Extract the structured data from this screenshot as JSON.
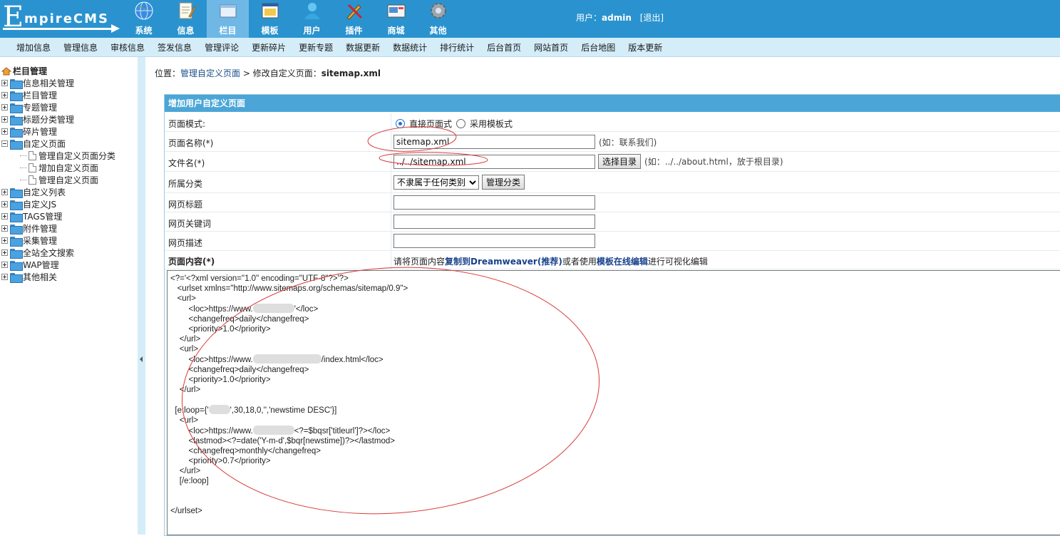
{
  "header": {
    "logo_initial": "E",
    "logo_rest": "mpireCMS",
    "nav": [
      {
        "label": "系统",
        "icon": "globe-icon"
      },
      {
        "label": "信息",
        "icon": "notepad-icon"
      },
      {
        "label": "栏目",
        "icon": "folder-icon"
      },
      {
        "label": "模板",
        "icon": "template-window-icon"
      },
      {
        "label": "用户",
        "icon": "user-icon"
      },
      {
        "label": "插件",
        "icon": "tools-icon"
      },
      {
        "label": "商城",
        "icon": "shop-icon"
      },
      {
        "label": "其他",
        "icon": "gear-icon"
      }
    ],
    "active_nav": "栏目",
    "user_prefix": "用户：",
    "username": "admin",
    "logout": "[退出]"
  },
  "submenu": [
    "增加信息",
    "管理信息",
    "审核信息",
    "签发信息",
    "管理评论",
    "更新碎片",
    "更新专题",
    "数据更新",
    "数据统计",
    "排行统计",
    "后台首页",
    "网站首页",
    "后台地图",
    "版本更新"
  ],
  "sidebar": {
    "title": "栏目管理",
    "items": [
      "信息相关管理",
      "栏目管理",
      "专题管理",
      "标题分类管理",
      "碎片管理",
      "自定义页面"
    ],
    "children": [
      "管理自定义页面分类",
      "增加自定义页面",
      "管理自定义页面"
    ],
    "items_after": [
      "自定义列表",
      "自定义JS",
      "TAGS管理",
      "附件管理",
      "采集管理",
      "全站全文搜索",
      "WAP管理",
      "其他相关"
    ]
  },
  "breadcrumb": {
    "prefix": "位置：",
    "link": "管理自定义页面",
    "sep": " > ",
    "current_prefix": "修改自定义页面：",
    "current": "sitemap.xml"
  },
  "form": {
    "title": "增加用户自定义页面",
    "mode_label": "页面模式:",
    "mode_direct": "直接页面式",
    "mode_template": "采用模板式",
    "name_label": "页面名称(*)",
    "name_value": "sitemap.xml",
    "name_hint": "(如：联系我们)",
    "file_label": "文件名(*)",
    "file_value": "../../sitemap.xml",
    "file_button": "选择目录",
    "file_hint": "(如：../../about.html，放于根目录)",
    "category_label": "所属分类",
    "category_value": "不隶属于任何类别",
    "category_button": "管理分类",
    "page_title_label": "网页标题",
    "keywords_label": "网页关键词",
    "description_label": "网页描述",
    "content_label": "页面内容(*)",
    "content_desc_1": "请将页面内容",
    "content_desc_link1": "复制到Dreamweaver(推荐)",
    "content_desc_2": "或者使用",
    "content_desc_link2": "模板在线编辑",
    "content_desc_3": "进行可视化编辑"
  },
  "code_lines": [
    "<?='<?xml version=\"1.0\" encoding=\"UTF-8\"?>'?>",
    "   <urlset xmlns=\"http://www.sitemaps.org/schemas/sitemap/0.9\">",
    "   <url>",
    "        <loc>https://www.",
    "'</loc>",
    "        <changefreq>daily</changefreq>",
    "        <priority>1.0</priority>",
    "    </url>",
    "    <url>",
    "        <loc>https://www.",
    "/index.html</loc>",
    "        <changefreq>daily</changefreq>",
    "        <priority>1.0</priority>",
    "    </url>",
    "",
    "  [e:loop={'",
    "',30,18,0,'','newstime DESC'}]",
    "    <url>",
    "        <loc>https://www.",
    "<?=$bqsr['titleurl']?></loc>",
    "        <lastmod><?=date('Y-m-d',$bqr[newstime])?></lastmod>",
    "        <changefreq>monthly</changefreq>",
    "        <priority>0.7</priority>",
    "    </url>",
    "    [/e:loop]",
    "",
    "",
    "</urlset>"
  ],
  "colors": {
    "header_bg": "#2a93cf",
    "active_tab": "#6fb8e6",
    "submenu_bg": "#d4edf9",
    "panel_head": "#4ba6d7",
    "annotation": "#d93a3a"
  }
}
